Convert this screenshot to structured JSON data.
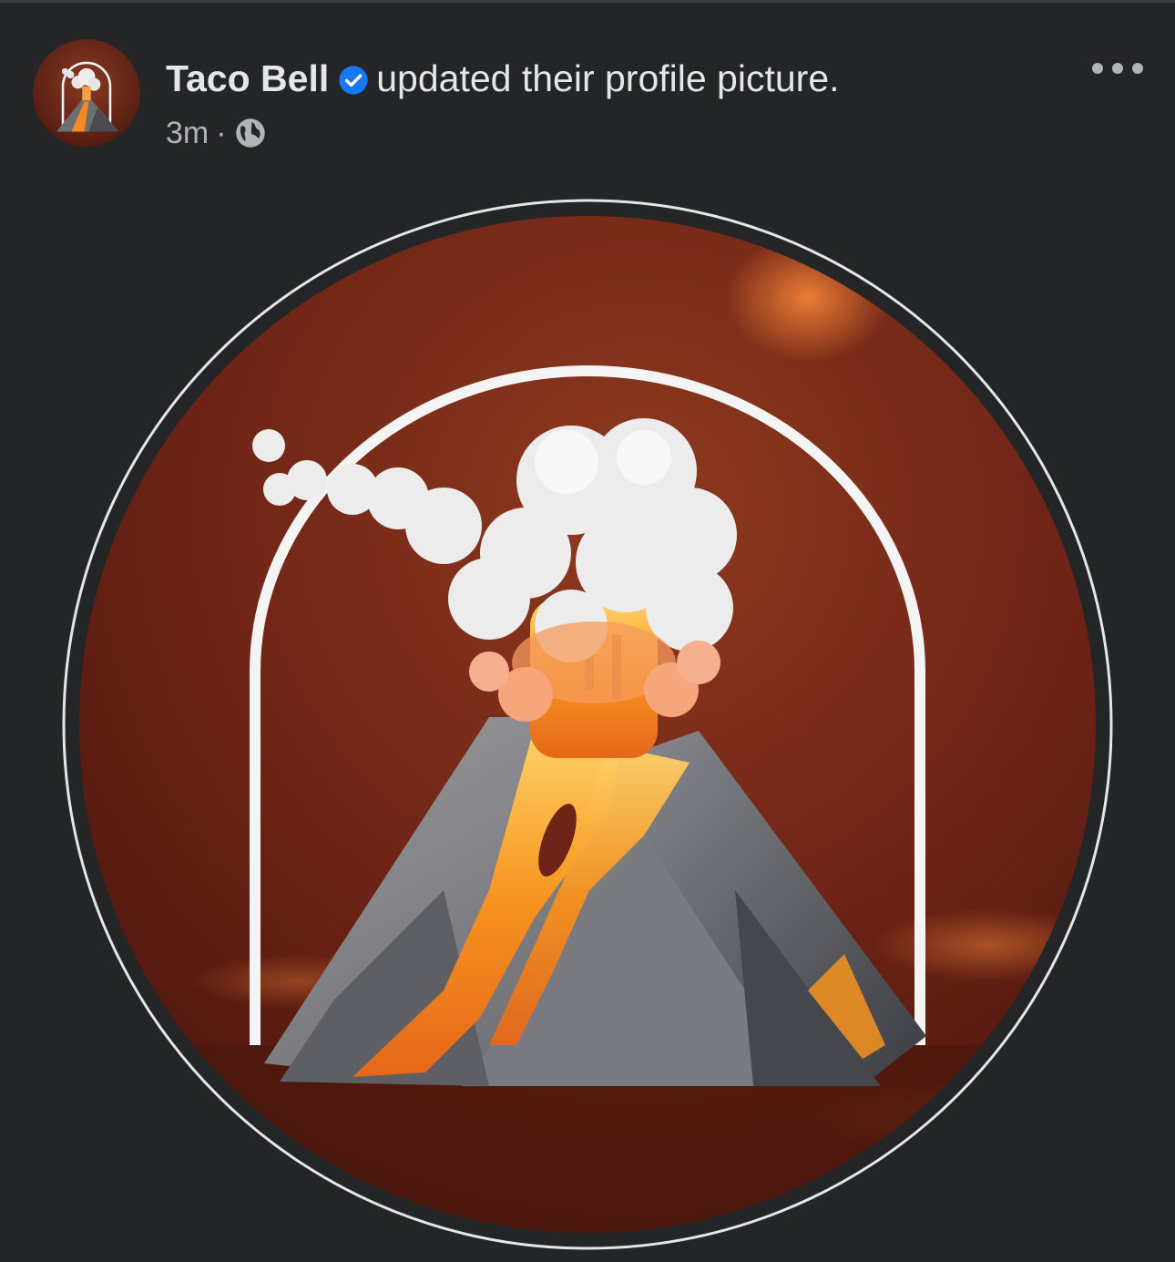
{
  "post": {
    "author": {
      "name": "Taco Bell",
      "verified_icon": "verified-badge-icon"
    },
    "action_text": "updated their profile picture.",
    "timestamp": "3m",
    "separator": "·",
    "audience_icon": "globe-icon",
    "more_icon": "more-horizontal-icon",
    "image": {
      "subject_icon": "volcano-icon"
    }
  },
  "colors": {
    "background": "#242526",
    "primary_text": "#e4e6eb",
    "secondary_text": "#b0b3b8",
    "verified_blue": "#1877f2",
    "ring": "#e4e6eb",
    "image_background": "#7a2a18",
    "lava": "#f58a1f",
    "smoke": "#e6e6e6",
    "rock": "#6d6e72"
  }
}
